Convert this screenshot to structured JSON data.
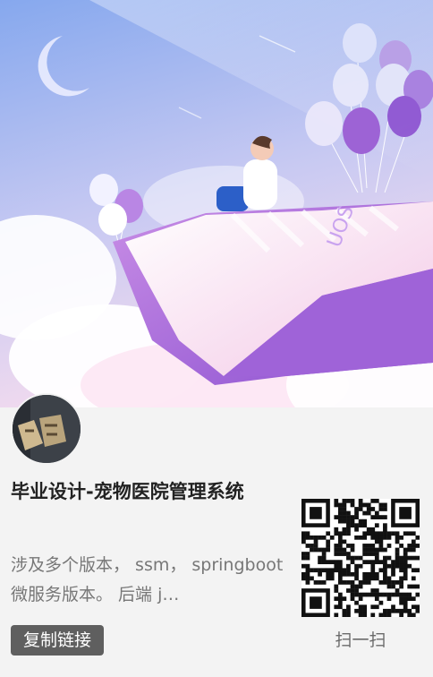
{
  "card": {
    "title": "毕业设计-宠物医院管理系统",
    "description": "涉及多个版本， ssm， springboot微服务版本。 后端 j…",
    "copy_link_label": "复制链接",
    "scan_label": "扫一扫"
  },
  "colors": {
    "background": "#f3f3f3",
    "button": "#5f5f5f",
    "sky_top": "#8fb0f0",
    "sky_bottom": "#f2d9ee",
    "book_purple": "#9d5fd6"
  },
  "icons": {
    "avatar": "avatar-image",
    "qr": "qr-code-icon"
  }
}
